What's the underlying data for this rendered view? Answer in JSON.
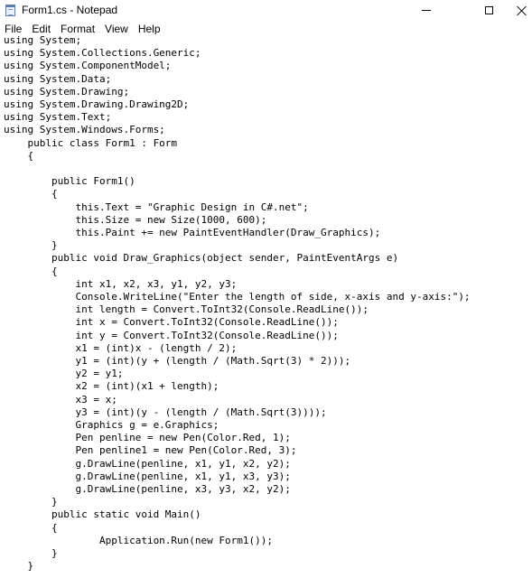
{
  "window": {
    "title": "Form1.cs - Notepad",
    "icon": "notepad-icon"
  },
  "menu": [
    "File",
    "Edit",
    "Format",
    "View",
    "Help"
  ],
  "editor": {
    "lines": [
      "using System;",
      "using System.Collections.Generic;",
      "using System.ComponentModel;",
      "using System.Data;",
      "using System.Drawing;",
      "using System.Drawing.Drawing2D;",
      "using System.Text;",
      "using System.Windows.Forms;",
      "    public class Form1 : Form",
      "    {",
      "",
      "        public Form1()",
      "        {",
      "            this.Text = \"Graphic Design in C#.net\";",
      "            this.Size = new Size(1000, 600);",
      "            this.Paint += new PaintEventHandler(Draw_Graphics);",
      "        }",
      "        public void Draw_Graphics(object sender, PaintEventArgs e)",
      "        {",
      "            int x1, x2, x3, y1, y2, y3;",
      "            Console.WriteLine(\"Enter the length of side, x-axis and y-axis:\");",
      "            int length = Convert.ToInt32(Console.ReadLine());",
      "            int x = Convert.ToInt32(Console.ReadLine());",
      "            int y = Convert.ToInt32(Console.ReadLine());",
      "            x1 = (int)x - (length / 2);",
      "            y1 = (int)(y + (length / (Math.Sqrt(3) * 2)));",
      "            y2 = y1;",
      "            x2 = (int)(x1 + length);",
      "            x3 = x;",
      "            y3 = (int)(y - (length / (Math.Sqrt(3))));",
      "            Graphics g = e.Graphics;",
      "            Pen penline = new Pen(Color.Red, 1);",
      "            Pen penline1 = new Pen(Color.Red, 3);",
      "            g.DrawLine(penline, x1, y1, x2, y2);",
      "            g.DrawLine(penline, x1, y1, x3, y3);",
      "            g.DrawLine(penline, x3, y3, x2, y2);",
      "        }",
      "        public static void Main()",
      "        {",
      "                Application.Run(new Form1());",
      "        }",
      "    }"
    ]
  }
}
